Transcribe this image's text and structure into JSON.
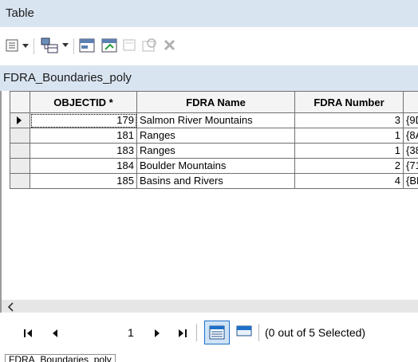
{
  "window": {
    "title": "Table"
  },
  "layer": {
    "name": "FDRA_Boundaries_poly"
  },
  "table": {
    "columns": [
      "OBJECTID *",
      "FDRA Name",
      "FDRA Number",
      ""
    ],
    "rows": [
      [
        "179",
        "Salmon River Mountains",
        "3",
        "{9D"
      ],
      [
        "181",
        "Ranges",
        "1",
        "{8A"
      ],
      [
        "183",
        "Ranges",
        "1",
        "{38"
      ],
      [
        "184",
        "Boulder Mountains",
        "2",
        "{71"
      ],
      [
        "185",
        "Basins and Rivers",
        "4",
        "{BE"
      ]
    ],
    "current_row_index": 0
  },
  "navigation": {
    "current_record": "1",
    "selection_status": "(0 out of 5 Selected)"
  },
  "tabs": [
    "FDRA_Boundaries_poly"
  ],
  "colors": {
    "titlebar": "#d9e4f1",
    "accent_blue": "#1e6fc8"
  }
}
